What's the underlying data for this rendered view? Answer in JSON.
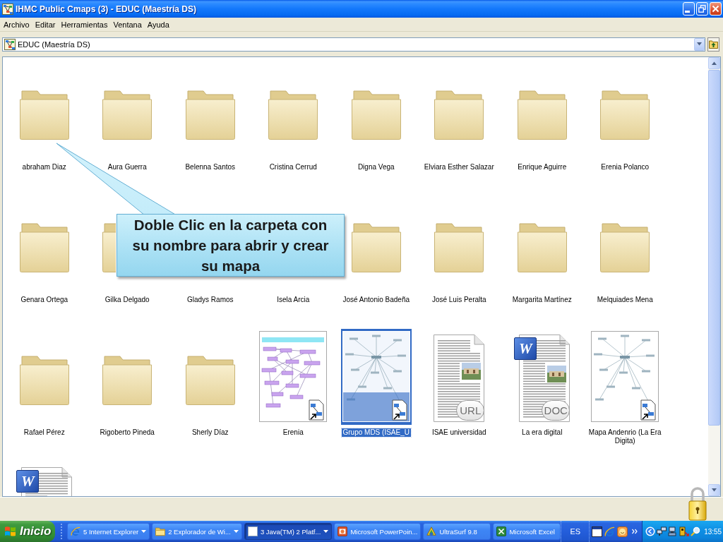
{
  "window": {
    "title": "IHMC Public Cmaps (3) - EDUC (Maestría DS)"
  },
  "menu": [
    "Archivo",
    "Editar",
    "Herramientas",
    "Ventana",
    "Ayuda"
  ],
  "address": {
    "value": "EDUC (Maestría DS)"
  },
  "items": [
    {
      "label": "abraham Diaz",
      "kind": "folder",
      "selected": false,
      "icon_covered": false,
      "icon_partly_covered": false
    },
    {
      "label": "Aura Guerra",
      "kind": "folder",
      "selected": false,
      "icon_covered": false,
      "icon_partly_covered": false
    },
    {
      "label": "Belenna Santos",
      "kind": "folder",
      "selected": false,
      "icon_covered": false,
      "icon_partly_covered": false
    },
    {
      "label": "Cristina Cerrud",
      "kind": "folder",
      "selected": false,
      "icon_covered": false,
      "icon_partly_covered": false
    },
    {
      "label": "Digna Vega",
      "kind": "folder",
      "selected": false,
      "icon_covered": false,
      "icon_partly_covered": false
    },
    {
      "label": "Elviara Esther Salazar",
      "kind": "folder",
      "selected": false,
      "icon_covered": false,
      "icon_partly_covered": false
    },
    {
      "label": "Enrique Aguirre",
      "kind": "folder",
      "selected": false,
      "icon_covered": false,
      "icon_partly_covered": false
    },
    {
      "label": "Erenia Polanco",
      "kind": "folder",
      "selected": false,
      "icon_covered": false,
      "icon_partly_covered": false
    },
    {
      "label": "Genara Ortega",
      "kind": "folder",
      "selected": false,
      "icon_covered": false,
      "icon_partly_covered": false
    },
    {
      "label": "Gilka Delgado",
      "kind": "folder",
      "selected": false,
      "icon_covered": false,
      "icon_partly_covered": true
    },
    {
      "label": "Gladys Ramos",
      "kind": "folder",
      "selected": false,
      "icon_covered": true,
      "icon_partly_covered": false
    },
    {
      "label": "Isela Arcia",
      "kind": "folder",
      "selected": false,
      "icon_covered": true,
      "icon_partly_covered": false
    },
    {
      "label": "José Antonio Badeña",
      "kind": "folder",
      "selected": false,
      "icon_covered": false,
      "icon_partly_covered": false
    },
    {
      "label": "José Luis Peralta",
      "kind": "folder",
      "selected": false,
      "icon_covered": false,
      "icon_partly_covered": false
    },
    {
      "label": "Margarita Martínez",
      "kind": "folder",
      "selected": false,
      "icon_covered": false,
      "icon_partly_covered": false
    },
    {
      "label": "Melquiades Mena",
      "kind": "folder",
      "selected": false,
      "icon_covered": false,
      "icon_partly_covered": false
    },
    {
      "label": "Rafael Pérez",
      "kind": "folder",
      "selected": false,
      "icon_covered": false,
      "icon_partly_covered": false
    },
    {
      "label": "Rigoberto Pineda",
      "kind": "folder",
      "selected": false,
      "icon_covered": false,
      "icon_partly_covered": false
    },
    {
      "label": "Sherly Díaz",
      "kind": "folder",
      "selected": false,
      "icon_covered": false,
      "icon_partly_covered": false
    },
    {
      "label": "Erenia",
      "kind": "map",
      "selected": false,
      "icon_covered": false,
      "icon_partly_covered": false
    },
    {
      "label": "Grupo MDS (ISAE_U",
      "kind": "map",
      "selected": true,
      "icon_covered": false,
      "icon_partly_covered": false
    },
    {
      "label": "ISAE universidad",
      "kind": "url",
      "selected": false,
      "icon_covered": false,
      "icon_partly_covered": false,
      "badge": "URL"
    },
    {
      "label": "La era digital",
      "kind": "doc",
      "selected": false,
      "icon_covered": false,
      "icon_partly_covered": false,
      "badge": "DOC",
      "logo": "W"
    },
    {
      "label": "Mapa Andenrio (La Era Digita)",
      "kind": "map",
      "selected": false,
      "icon_covered": false,
      "icon_partly_covered": false
    },
    {
      "kind": "doc",
      "selected": false,
      "icon_covered": false,
      "icon_partly_covered": false,
      "logo": "W"
    }
  ],
  "callout": {
    "text": "Doble Clic en la carpeta con su nombre para abrir y crear su mapa"
  },
  "taskbar": {
    "start": "Inicio",
    "tasks": [
      {
        "label": "5 Internet Explorer",
        "kind": "browser",
        "grouped": true,
        "selected": false
      },
      {
        "label": "2 Explorador de Wi...",
        "kind": "folder",
        "grouped": true,
        "selected": false
      },
      {
        "label": "3 Java(TM) 2 Platf...",
        "kind": "window",
        "grouped": true,
        "selected": true
      },
      {
        "label": "Microsoft PowerPoin...",
        "kind": "slides",
        "grouped": false,
        "selected": false
      },
      {
        "label": "UltraSurf 9.8",
        "kind": "program",
        "grouped": false,
        "selected": false
      },
      {
        "label": "Microsoft Excel",
        "kind": "spreadsheet",
        "grouped": false,
        "selected": false
      }
    ],
    "language": "ES",
    "clock": "13:55"
  }
}
